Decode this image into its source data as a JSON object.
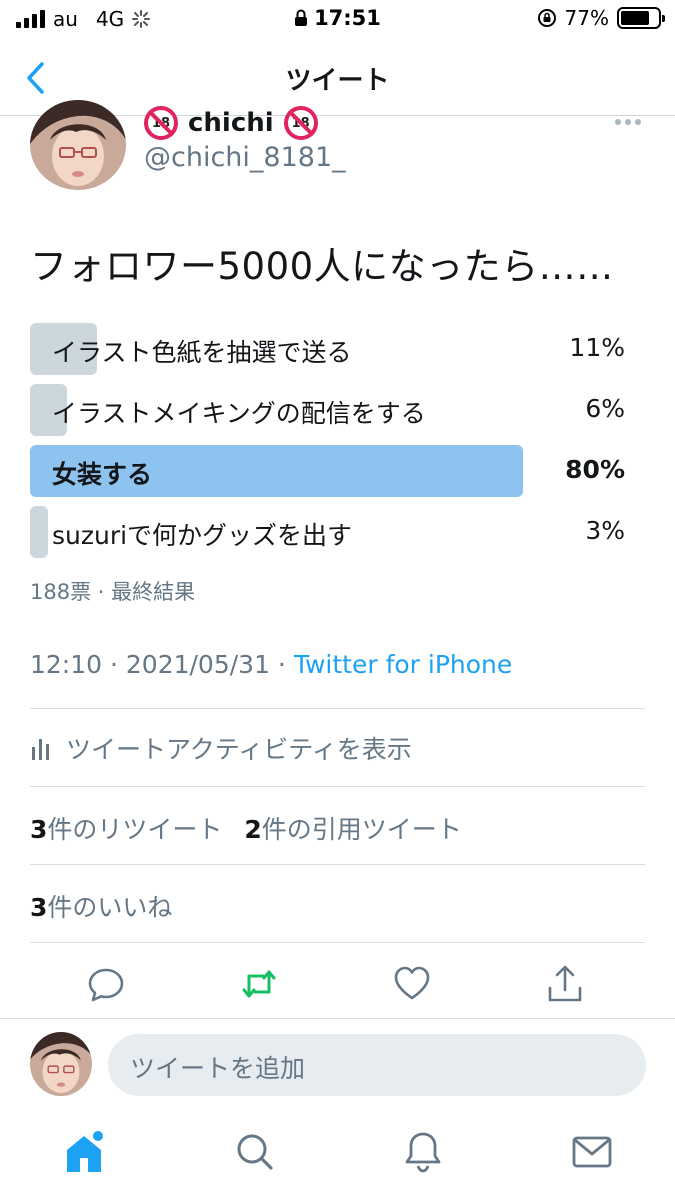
{
  "status_bar": {
    "carrier": "au",
    "network": "4G",
    "time": "17:51",
    "battery": "77%",
    "battery_level": 0.77
  },
  "nav": {
    "title": "ツイート",
    "back_icon": "chevron-left-icon"
  },
  "tweet": {
    "display_name": "chichi",
    "handle": "@chichi_8181_",
    "text": "フォロワー5000人になったら……",
    "poll": {
      "options": [
        {
          "label": "イラスト色紙を抽選で送る",
          "percent": "11%",
          "value": 11
        },
        {
          "label": "イラストメイキングの配信をする",
          "percent": "6%",
          "value": 6
        },
        {
          "label": "女装する",
          "percent": "80%",
          "value": 80
        },
        {
          "label": "suzuriで何かグッズを出す",
          "percent": "3%",
          "value": 3
        }
      ],
      "meta": "188票 · 最終結果"
    },
    "time": "12:10 · 2021/05/31 · ",
    "via": "Twitter for iPhone",
    "activity": "ツイートアクティビティを表示",
    "retweets_count": "3",
    "retweets_label": "件のリツイート",
    "quotes_count": "2",
    "quotes_label": "件の引用ツイート",
    "likes_count": "3",
    "likes_label": "件のいいね"
  },
  "reply": {
    "placeholder": "ツイートを追加"
  },
  "colors": {
    "accent": "#1da1f2",
    "retweet": "#17bf63",
    "poll_winner": "#8ec2ef",
    "poll_other": "#ccd6dd",
    "muted": "#657786"
  }
}
